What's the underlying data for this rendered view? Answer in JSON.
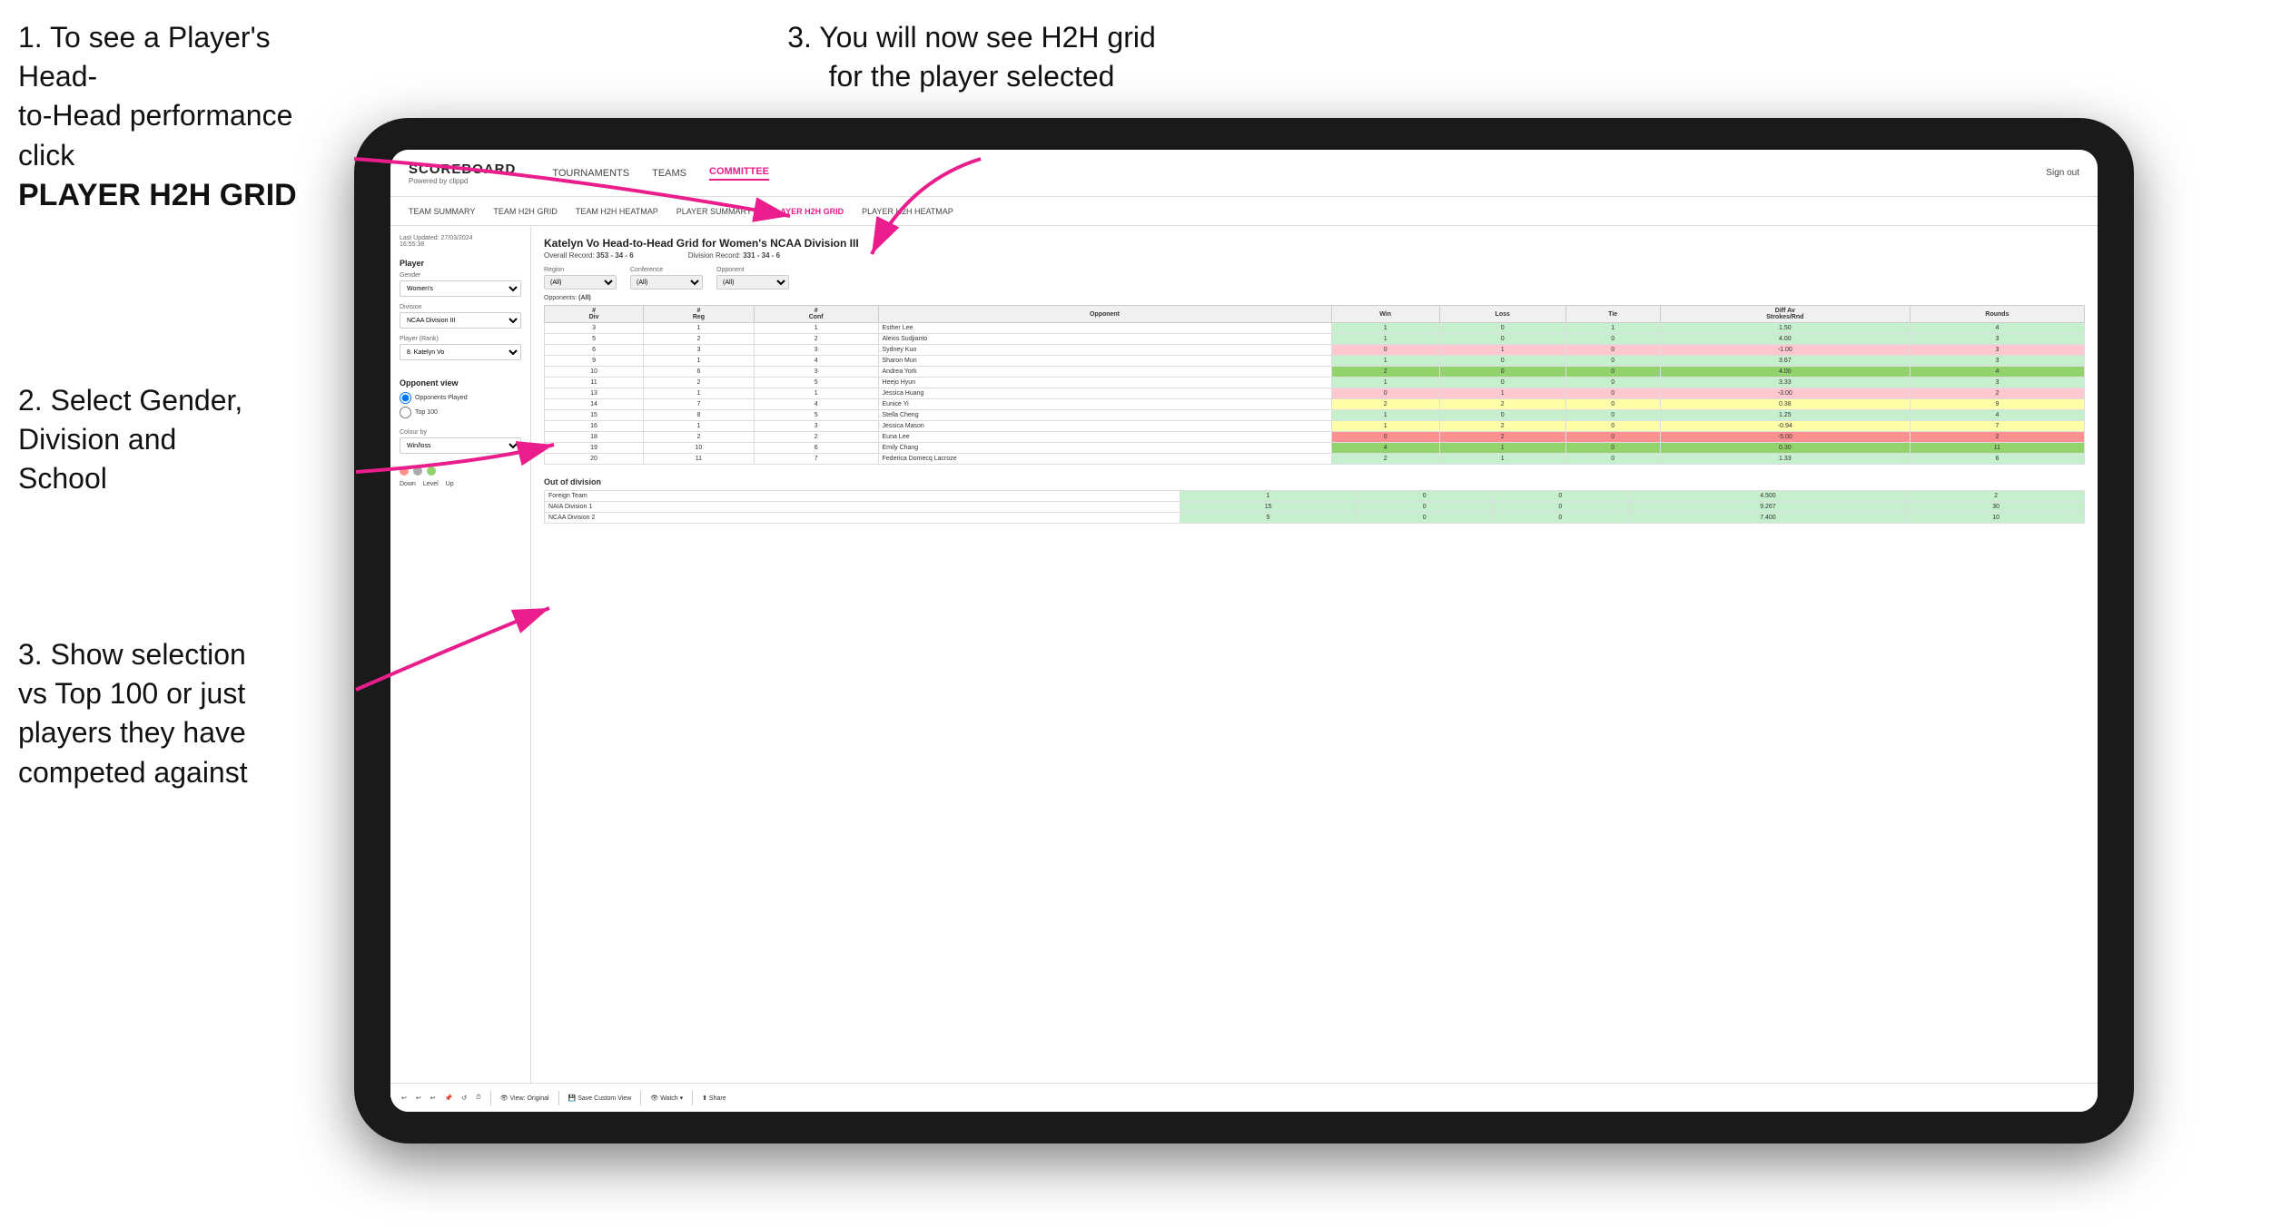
{
  "instructions": {
    "top_left_line1": "1. To see a Player's Head-",
    "top_left_line2": "to-Head performance click",
    "top_left_bold": "PLAYER H2H GRID",
    "top_right": "3. You will now see H2H grid\nfor the player selected",
    "mid_left_title": "2. Select Gender,\nDivision and\nSchool",
    "bot_left": "3. Show selection\nvs Top 100 or just\nplayers they have\ncompeted against"
  },
  "navbar": {
    "logo": "SCOREBOARD",
    "logo_sub": "Powered by clippd",
    "links": [
      "TOURNAMENTS",
      "TEAMS",
      "COMMITTEE"
    ],
    "active_link": "COMMITTEE",
    "sign_out": "Sign out"
  },
  "subnav": {
    "links": [
      "TEAM SUMMARY",
      "TEAM H2H GRID",
      "TEAM H2H HEATMAP",
      "PLAYER SUMMARY",
      "PLAYER H2H GRID",
      "PLAYER H2H HEATMAP"
    ],
    "active": "PLAYER H2H GRID"
  },
  "left_panel": {
    "timestamp": "Last Updated: 27/03/2024\n16:55:38",
    "player_section": "Player",
    "gender_label": "Gender",
    "gender_value": "Women's",
    "division_label": "Division",
    "division_value": "NCAA Division III",
    "player_rank_label": "Player (Rank)",
    "player_rank_value": "8. Katelyn Vo",
    "opponent_view_title": "Opponent view",
    "opponent_options": [
      "Opponents Played",
      "Top 100"
    ],
    "opponent_selected": "Opponents Played",
    "colour_by_label": "Colour by",
    "colour_value": "Win/loss",
    "colour_labels": [
      "Down",
      "Level",
      "Up"
    ]
  },
  "main": {
    "title": "Katelyn Vo Head-to-Head Grid for Women's NCAA Division III",
    "overall_record": "353 - 34 - 6",
    "division_record": "331 - 34 - 6",
    "filter_regions": [
      "(All)",
      "(All)",
      "(All)"
    ],
    "region_label": "Region",
    "conference_label": "Conference",
    "opponent_label": "Opponent",
    "opponents_label": "Opponents:",
    "table_headers": [
      "# Div",
      "# Reg",
      "# Conf",
      "Opponent",
      "Win",
      "Loss",
      "Tie",
      "Diff Av Strokes/Rnd",
      "Rounds"
    ],
    "rows": [
      {
        "div": 3,
        "reg": 1,
        "conf": 1,
        "opponent": "Esther Lee",
        "win": 1,
        "loss": 0,
        "tie": 1,
        "diff": "1.50",
        "rounds": 4,
        "color": "win-green"
      },
      {
        "div": 5,
        "reg": 2,
        "conf": 2,
        "opponent": "Alexis Sudjianto",
        "win": 1,
        "loss": 0,
        "tie": 0,
        "diff": "4.00",
        "rounds": 3,
        "color": "win-green"
      },
      {
        "div": 6,
        "reg": 3,
        "conf": 3,
        "opponent": "Sydney Kuo",
        "win": 0,
        "loss": 1,
        "tie": 0,
        "diff": "-1.00",
        "rounds": 3,
        "color": "loss-red"
      },
      {
        "div": 9,
        "reg": 1,
        "conf": 4,
        "opponent": "Sharon Mun",
        "win": 1,
        "loss": 0,
        "tie": 0,
        "diff": "3.67",
        "rounds": 3,
        "color": "win-green"
      },
      {
        "div": 10,
        "reg": 6,
        "conf": 3,
        "opponent": "Andrea York",
        "win": 2,
        "loss": 0,
        "tie": 0,
        "diff": "4.00",
        "rounds": 4,
        "color": "win-green2"
      },
      {
        "div": 11,
        "reg": 2,
        "conf": 5,
        "opponent": "Heejo Hyun",
        "win": 1,
        "loss": 0,
        "tie": 0,
        "diff": "3.33",
        "rounds": 3,
        "color": "win-green"
      },
      {
        "div": 13,
        "reg": 1,
        "conf": 1,
        "opponent": "Jessica Huang",
        "win": 0,
        "loss": 1,
        "tie": 0,
        "diff": "-3.00",
        "rounds": 2,
        "color": "loss-red"
      },
      {
        "div": 14,
        "reg": 7,
        "conf": 4,
        "opponent": "Eunice Yi",
        "win": 2,
        "loss": 2,
        "tie": 0,
        "diff": "0.38",
        "rounds": 9,
        "color": "win-yellow"
      },
      {
        "div": 15,
        "reg": 8,
        "conf": 5,
        "opponent": "Stella Cheng",
        "win": 1,
        "loss": 0,
        "tie": 0,
        "diff": "1.25",
        "rounds": 4,
        "color": "win-green"
      },
      {
        "div": 16,
        "reg": 1,
        "conf": 3,
        "opponent": "Jessica Mason",
        "win": 1,
        "loss": 2,
        "tie": 0,
        "diff": "-0.94",
        "rounds": 7,
        "color": "win-yellow"
      },
      {
        "div": 18,
        "reg": 2,
        "conf": 2,
        "opponent": "Euna Lee",
        "win": 0,
        "loss": 2,
        "tie": 0,
        "diff": "-5.00",
        "rounds": 2,
        "color": "loss-red2"
      },
      {
        "div": 19,
        "reg": 10,
        "conf": 6,
        "opponent": "Emily Chang",
        "win": 4,
        "loss": 1,
        "tie": 0,
        "diff": "0.30",
        "rounds": 11,
        "color": "win-green2"
      },
      {
        "div": 20,
        "reg": 11,
        "conf": 7,
        "opponent": "Federica Domecq Lacroze",
        "win": 2,
        "loss": 1,
        "tie": 0,
        "diff": "1.33",
        "rounds": 6,
        "color": "win-green"
      }
    ],
    "out_of_division_title": "Out of division",
    "out_of_division_rows": [
      {
        "label": "Foreign Team",
        "win": 1,
        "loss": 0,
        "tie": 0,
        "diff": "4.500",
        "rounds": 2
      },
      {
        "label": "NAIA Division 1",
        "win": 15,
        "loss": 0,
        "tie": 0,
        "diff": "9.267",
        "rounds": 30
      },
      {
        "label": "NCAA Division 2",
        "win": 5,
        "loss": 0,
        "tie": 0,
        "diff": "7.400",
        "rounds": 10
      }
    ]
  },
  "toolbar": {
    "buttons": [
      "View: Original",
      "Save Custom View",
      "Watch",
      "Share"
    ],
    "icons": [
      "undo",
      "undo2",
      "undo3",
      "pin",
      "redo",
      "clock"
    ]
  },
  "colours": {
    "arrow": "#e91e8c",
    "nav_active": "#e91e8c",
    "win_dark": "#92d36e",
    "win_light": "#c6efce",
    "loss_light": "#ffc7ce",
    "loss_dark": "#ff9090",
    "tie": "#ffffaa"
  }
}
